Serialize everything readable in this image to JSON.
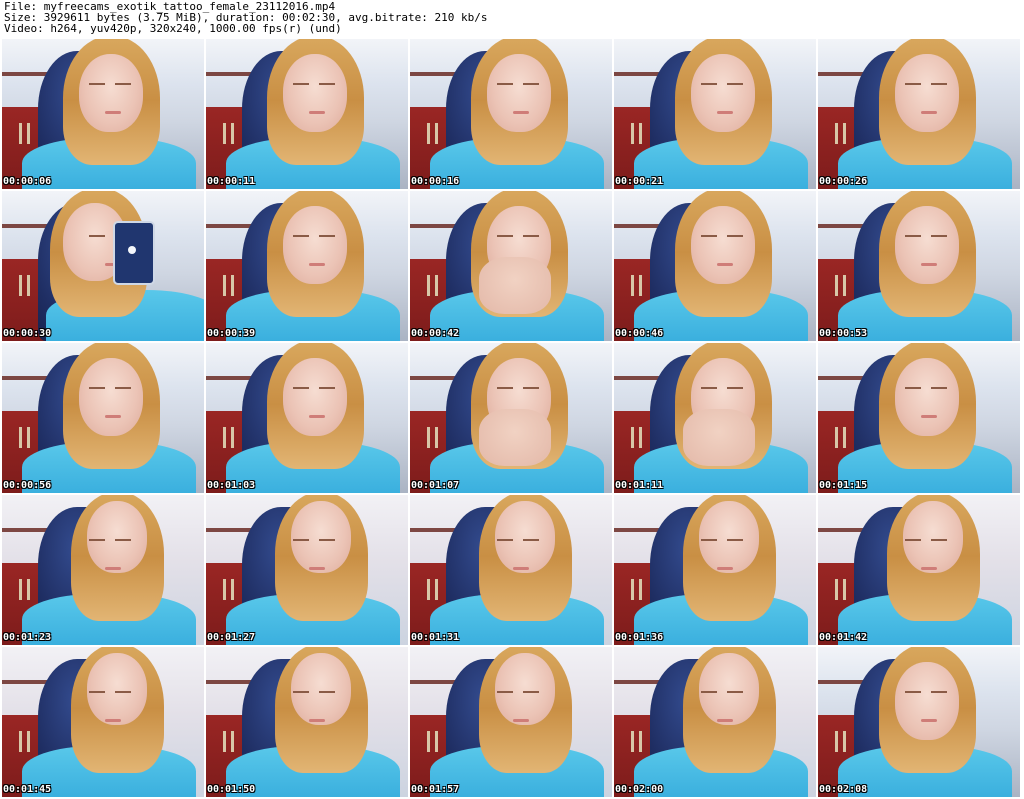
{
  "header": {
    "file_line": "File: myfreecams_exotik_tattoo_female_23112016.mp4",
    "size_line": "Size: 3929611 bytes (3.75 MiB), duration: 00:02:30, avg.bitrate: 210 kb/s",
    "video_line": "Video: h264, yuv420p, 320x240, 1000.00 fps(r) (und)"
  },
  "thumbnails": [
    {
      "timestamp": "00:00:06",
      "variant": "default"
    },
    {
      "timestamp": "00:00:11",
      "variant": "default"
    },
    {
      "timestamp": "00:00:16",
      "variant": "default"
    },
    {
      "timestamp": "00:00:21",
      "variant": "default"
    },
    {
      "timestamp": "00:00:26",
      "variant": "default"
    },
    {
      "timestamp": "00:00:30",
      "variant": "phone"
    },
    {
      "timestamp": "00:00:39",
      "variant": "default"
    },
    {
      "timestamp": "00:00:42",
      "variant": "hands"
    },
    {
      "timestamp": "00:00:46",
      "variant": "default"
    },
    {
      "timestamp": "00:00:53",
      "variant": "default"
    },
    {
      "timestamp": "00:00:56",
      "variant": "default"
    },
    {
      "timestamp": "00:01:03",
      "variant": "default"
    },
    {
      "timestamp": "00:01:07",
      "variant": "hands"
    },
    {
      "timestamp": "00:01:11",
      "variant": "hands"
    },
    {
      "timestamp": "00:01:15",
      "variant": "default"
    },
    {
      "timestamp": "00:01:23",
      "variant": "portrait"
    },
    {
      "timestamp": "00:01:27",
      "variant": "portrait"
    },
    {
      "timestamp": "00:01:31",
      "variant": "portrait"
    },
    {
      "timestamp": "00:01:36",
      "variant": "portrait"
    },
    {
      "timestamp": "00:01:42",
      "variant": "portrait"
    },
    {
      "timestamp": "00:01:45",
      "variant": "portrait"
    },
    {
      "timestamp": "00:01:50",
      "variant": "portrait"
    },
    {
      "timestamp": "00:01:57",
      "variant": "portrait"
    },
    {
      "timestamp": "00:02:00",
      "variant": "portrait"
    },
    {
      "timestamp": "00:02:08",
      "variant": "default"
    }
  ]
}
